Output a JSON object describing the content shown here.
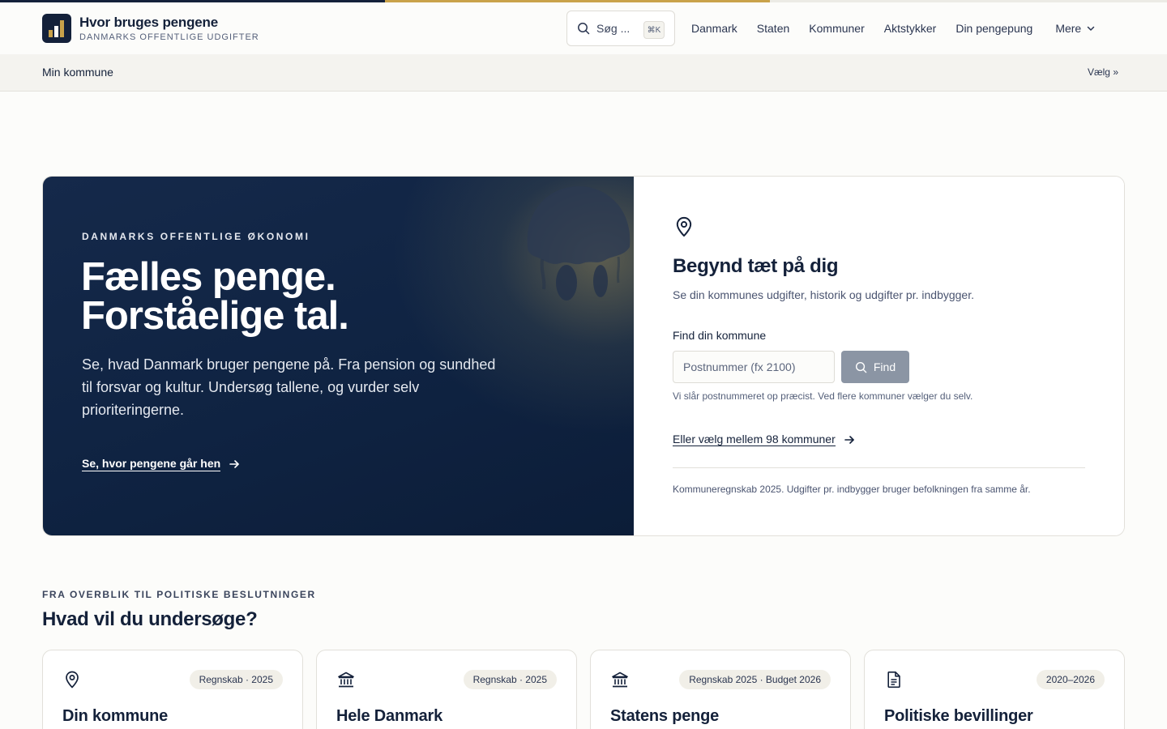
{
  "header": {
    "title": "Hvor bruges pengene",
    "subtitle": "DANMARKS OFFENTLIGE UDGIFTER",
    "search_placeholder": "Søg ...",
    "search_shortcut": "⌘K",
    "nav": [
      "Danmark",
      "Staten",
      "Kommuner",
      "Aktstykker",
      "Din pengepung"
    ],
    "more_label": "Mere"
  },
  "subbar": {
    "label": "Min kommune",
    "choose": "Vælg »"
  },
  "hero": {
    "eyebrow": "DANMARKS OFFENTLIGE ØKONOMI",
    "headline_line1": "Fælles penge.",
    "headline_line2": "Forståelige tal.",
    "lead": "Se, hvad Danmark bruger pengene på. Fra pension og sundhed til forsvar og kultur. Undersøg tallene, og vurder selv prioriteringerne.",
    "link": "Se, hvor pengene går hen"
  },
  "finder": {
    "title": "Begynd tæt på dig",
    "subtitle": "Se din kommunes udgifter, historik og udgifter pr. indbygger.",
    "label": "Find din kommune",
    "placeholder": "Postnummer (fx 2100)",
    "button": "Find",
    "hint": "Vi slår postnummeret op præcist. Ved flere kommuner vælger du selv.",
    "choose_link": "Eller vælg mellem 98 kommuner",
    "note": "Kommuneregnskab 2025. Udgifter pr. indbygger bruger befolkningen fra samme år."
  },
  "section": {
    "eyebrow": "FRA OVERBLIK TIL POLITISKE BESLUTNINGER",
    "title": "Hvad vil du undersøge?"
  },
  "cards": [
    {
      "icon": "map-pin-icon",
      "badge": "Regnskab · 2025",
      "title": "Din kommune"
    },
    {
      "icon": "institution-icon",
      "badge": "Regnskab · 2025",
      "title": "Hele Danmark"
    },
    {
      "icon": "institution-icon",
      "badge": "Regnskab 2025 · Budget 2026",
      "title": "Statens penge"
    },
    {
      "icon": "document-icon",
      "badge": "2020–2026",
      "title": "Politiske bevillinger"
    }
  ],
  "colors": {
    "navy": "#14213a",
    "gold": "#c9a24a",
    "hero_bg": "#0f2342",
    "button_disabled": "#8b95a4"
  }
}
